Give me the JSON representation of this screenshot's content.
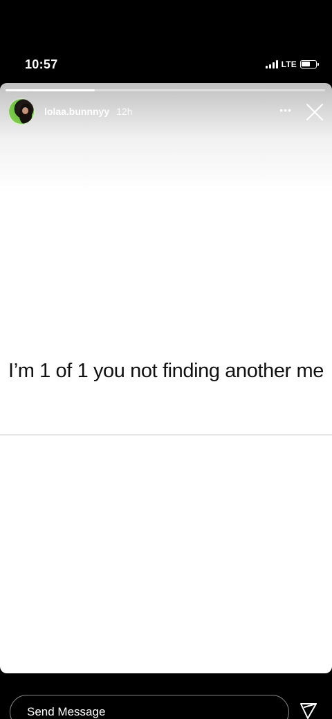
{
  "status_bar": {
    "time": "10:57",
    "network": "LTE",
    "icons": [
      "signal-icon",
      "battery-icon"
    ]
  },
  "story": {
    "progress": 0.28,
    "username": "lolaa.bunnnyy",
    "time_ago": "12h",
    "more_glyph": "•••",
    "text": "I’m 1 of 1 you not finding another me"
  },
  "footer": {
    "message_placeholder": "Send Message",
    "icons": [
      "send-icon"
    ]
  },
  "colors": {
    "background": "#000000",
    "card": "#ffffff",
    "text_dark": "#111111"
  }
}
